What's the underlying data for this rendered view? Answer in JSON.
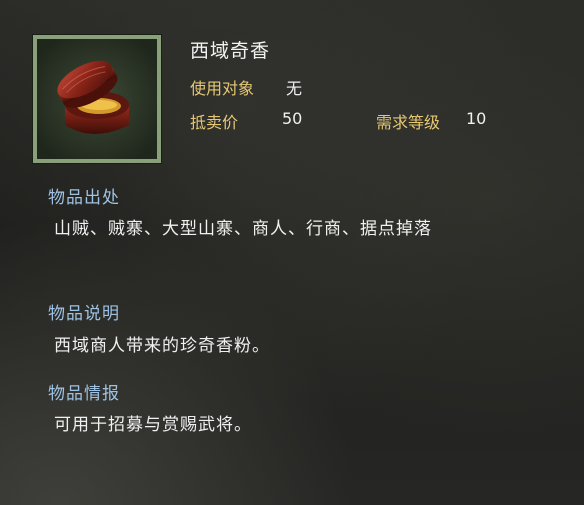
{
  "item": {
    "name": "西域奇香",
    "target_label": "使用对象",
    "target_value": "无",
    "price_label": "抵卖价",
    "price_value": "50",
    "level_label": "需求等级",
    "level_value": "10"
  },
  "sections": {
    "source": {
      "title": "物品出处",
      "text": "山贼、贼寨、大型山寨、商人、行商、据点掉落"
    },
    "description": {
      "title": "物品说明",
      "text": "西域商人带来的珍奇香粉。"
    },
    "intel": {
      "title": "物品情报",
      "text": "可用于招募与赏赐武将。"
    }
  },
  "colors": {
    "label": "#e6c874",
    "section_title": "#9ec3e4",
    "frame": "#8aa07a"
  }
}
